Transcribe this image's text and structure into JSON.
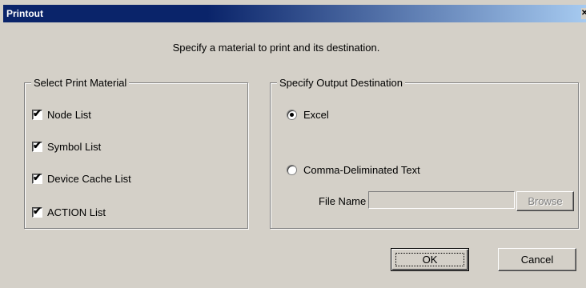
{
  "window": {
    "title": "Printout",
    "close_glyph": "✕"
  },
  "instruction": "Specify a material to print and its destination.",
  "material": {
    "legend": "Select Print Material",
    "items": [
      {
        "label": "Node List",
        "checked": true
      },
      {
        "label": "Symbol List",
        "checked": true
      },
      {
        "label": "Device Cache List",
        "checked": true
      },
      {
        "label": "ACTION List",
        "checked": true
      }
    ]
  },
  "output": {
    "legend": "Specify Output Destination",
    "options": [
      {
        "label": "Excel",
        "selected": true
      },
      {
        "label": "Comma-Deliminated Text",
        "selected": false
      }
    ],
    "file_name_label": "File Name",
    "file_name_value": "",
    "browse_label": "Browse"
  },
  "buttons": {
    "ok_label": "OK",
    "cancel_label": "Cancel"
  },
  "icons": {
    "checkmark": "checkmark-icon",
    "radio_dot": "radio-dot-icon",
    "close": "close-icon"
  }
}
